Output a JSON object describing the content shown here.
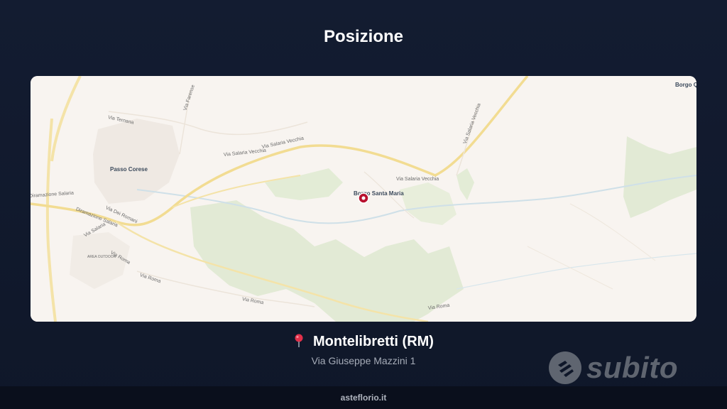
{
  "header": {
    "title": "Posizione"
  },
  "map": {
    "labels": {
      "passo_corese": "Passo Corese",
      "borgo_santa_maria": "Borgo Santa Maria",
      "borgo_q": "Borgo Q",
      "via_salaria_vecchia_1": "Via Salaria Vecchia",
      "via_salaria_vecchia_2": "Via Salaria Vecchia",
      "via_salaria_vecchia_3": "Via Salaria Vecchia",
      "via_salaria_vecchia_4": "Via Salaria Vecchia",
      "via_salaria": "Via Salaria",
      "diramazione_salaria_1": "Diramazione Salaria",
      "diramazione_salaria_2": "Diramazione Salaria",
      "via_ternana": "Via Ternana",
      "via_farense": "Via Farense",
      "via_dei_romani": "Via Dei Romani",
      "via_roma_1": "Via Roma",
      "via_roma_2": "Via Roma",
      "via_roma_3": "Via Roma",
      "via_roma_4": "Via Roma",
      "area_outdoor": "AREA OUTDOOR"
    }
  },
  "location": {
    "city": "Montelibretti (RM)",
    "address": "Via Giuseppe Mazzini 1"
  },
  "brand": {
    "name": "subito"
  },
  "footer": {
    "site": "asteflorio.it"
  }
}
